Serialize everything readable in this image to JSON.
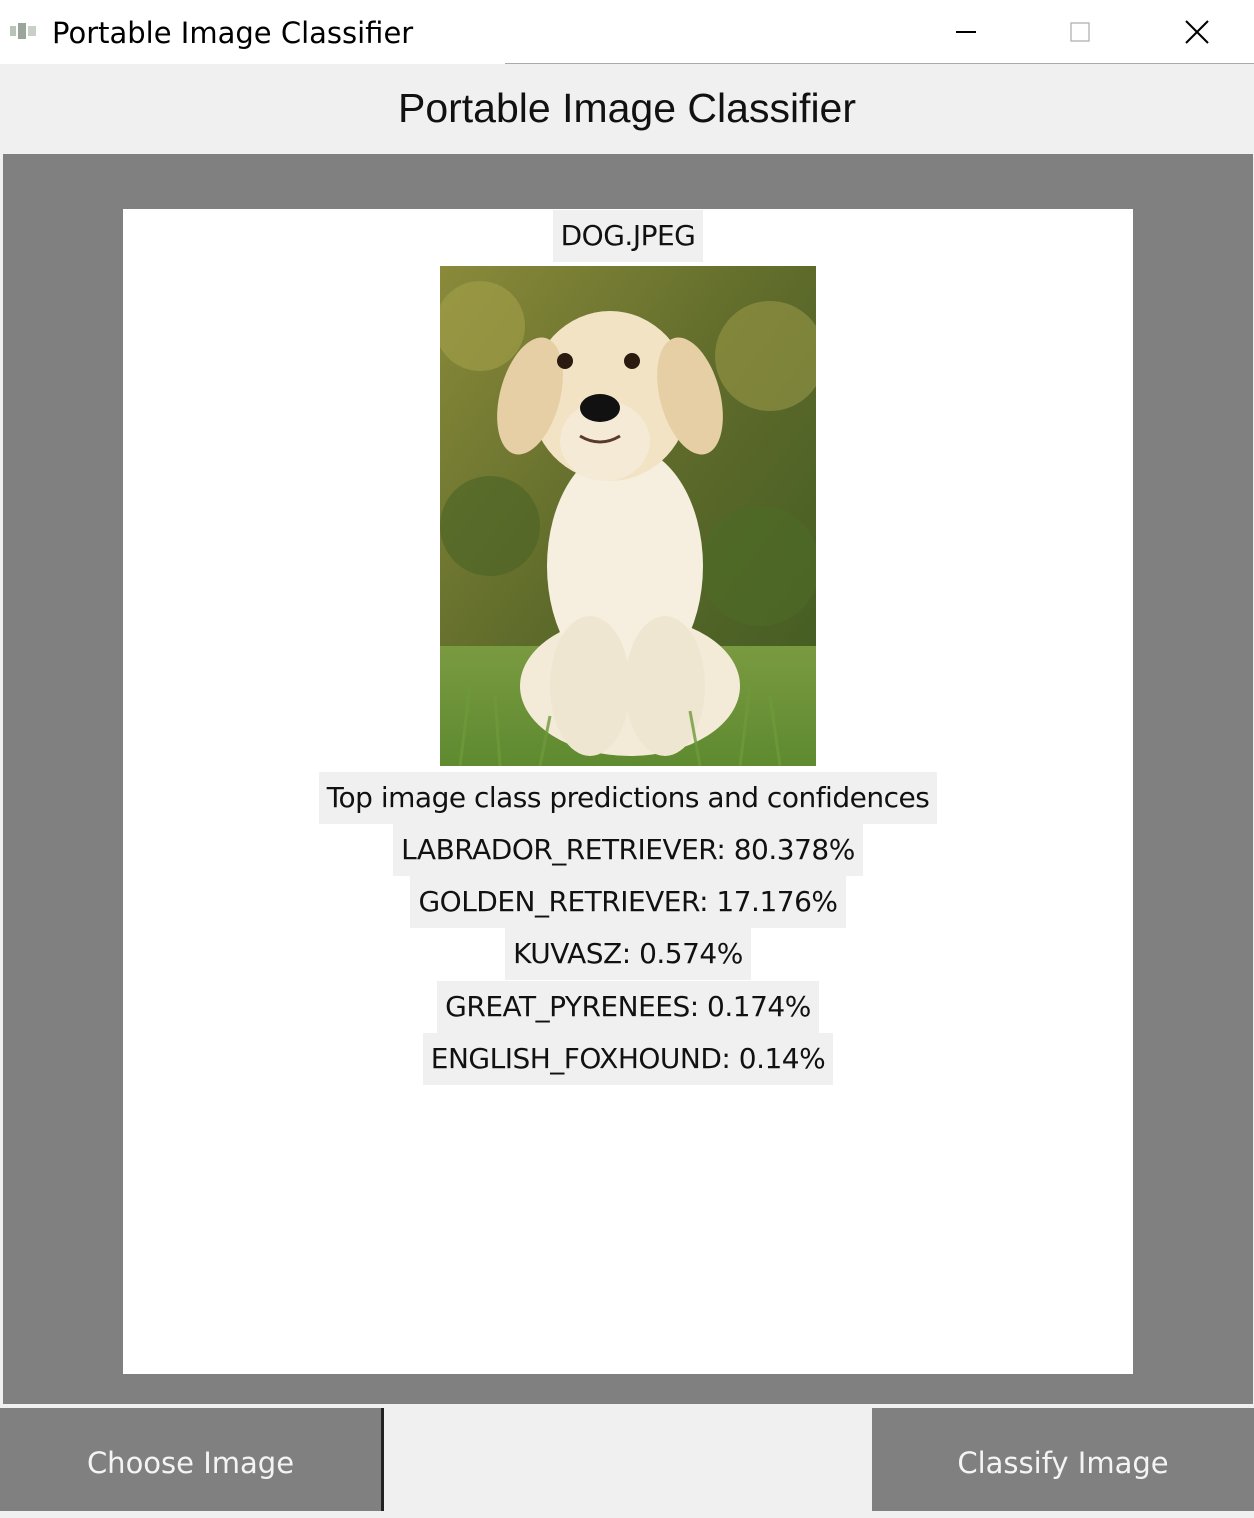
{
  "window": {
    "title": "Portable Image Classifier",
    "controls": {
      "minimize": "minimize",
      "maximize": "maximize",
      "close": "close"
    }
  },
  "header": {
    "title": "Portable Image Classifier"
  },
  "image": {
    "filename": "DOG.JPEG",
    "icon": "dog-photo"
  },
  "predictions": {
    "heading": "Top image class predictions and confidences",
    "items": [
      "LABRADOR_RETRIEVER: 80.378%",
      "GOLDEN_RETRIEVER: 17.176%",
      "KUVASZ: 0.574%",
      "GREAT_PYRENEES: 0.174%",
      "ENGLISH_FOXHOUND: 0.14%"
    ]
  },
  "buttons": {
    "choose_image": "Choose Image",
    "classify_image": "Classify Image"
  },
  "colors": {
    "frame": "#808080",
    "panel": "#ffffff",
    "label_bg": "#f0f0f0",
    "button_bg": "#808080",
    "button_text": "#f4f4f4"
  }
}
